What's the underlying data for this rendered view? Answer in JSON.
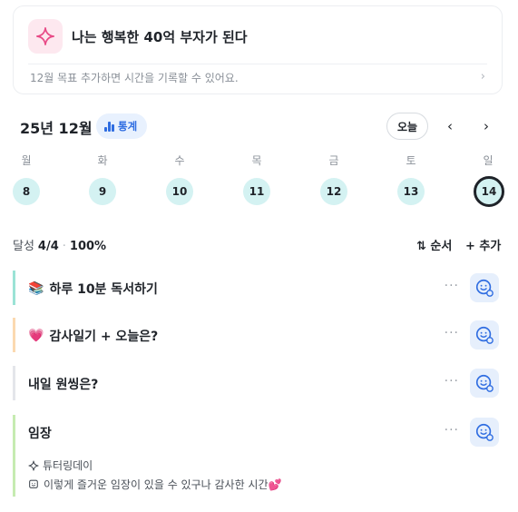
{
  "goal": {
    "title": "나는 행복한 40억 부자가 된다",
    "hint": "12월 목표  추가하면 시간을 기록할 수 있어요.",
    "chevron": "›",
    "icon": "sparkle-icon"
  },
  "header": {
    "month": "25년 12월",
    "stats_label": "통계",
    "today_label": "오늘",
    "prev": "‹",
    "next": "›"
  },
  "week": {
    "weekdays": [
      "월",
      "화",
      "수",
      "목",
      "금",
      "토",
      "일"
    ],
    "days": [
      "8",
      "9",
      "10",
      "11",
      "12",
      "13",
      "14"
    ],
    "today_index": 6
  },
  "progress": {
    "label": "달성",
    "count": "4/4",
    "separator": "·",
    "percent": "100%",
    "order_label": "⇅ 순서",
    "add_label": "+ 추가"
  },
  "tasks": [
    {
      "emoji": "📚",
      "title": "하루 10분 독서하기",
      "accent": "#9be3d6"
    },
    {
      "emoji": "💗",
      "title": "감사일기 + 오늘은?",
      "accent": "#fbd9b0"
    },
    {
      "emoji": "",
      "title": "내일 원씽은?",
      "accent": "#e4e6ea"
    },
    {
      "emoji": "",
      "title": "임장",
      "accent": "#c6ebb1",
      "tag": "튜터링데이",
      "note": "이렇게 즐거운 임장이 있을 수 있구나 감사한 시간💕"
    }
  ],
  "more_label": "···",
  "colors": {
    "accent_blue": "#2f6de1",
    "day_bg": "#d4f2f2",
    "react_bg": "#e6effc"
  }
}
